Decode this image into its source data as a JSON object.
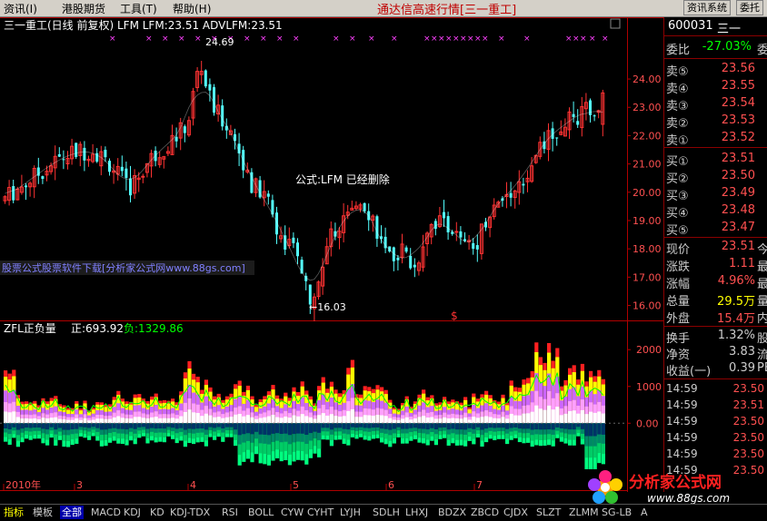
{
  "menu": {
    "items": [
      "资讯(I)",
      "港股期货",
      "工具(T)",
      "帮助(H)"
    ],
    "title": "通达信高速行情[三一重工]",
    "buttons": [
      "资讯系统",
      "委托"
    ]
  },
  "main_chart": {
    "header": "三一重工(日线 前复权) LFM LFM:23.51 ADVLFM:23.51",
    "annotations": {
      "high": "24.69",
      "low": "←16.03",
      "formula_note": "公式:LFM 已经删除",
      "watermark_text": "股票公式股票软件下载[分析家公式网www.88gs.com]",
      "dollar_mark": "$"
    },
    "y_axis_labels": [
      "24.00",
      "23.00",
      "22.00",
      "21.00",
      "20.00",
      "19.00",
      "18.00",
      "17.00",
      "16.00"
    ]
  },
  "sub_chart": {
    "header_name": "ZFL正负量",
    "pos_label": "正:693.92",
    "neg_label": "负:1329.86",
    "y_axis_labels": [
      "2000",
      "1000",
      "0.00"
    ]
  },
  "date_axis": [
    "2010年",
    "3",
    "4",
    "5",
    "6",
    "7"
  ],
  "chart_data": {
    "type": "candlestick",
    "title": "三一重工(日线 前复权)",
    "ylim": [
      15.6,
      24.9
    ],
    "high": 24.69,
    "low": 16.03,
    "last": 23.51,
    "sub_ylim": [
      -1300,
      2400
    ],
    "pos_last": 693.92,
    "neg_last": 1329.86
  },
  "quote": {
    "code": "600031",
    "name": "三一",
    "weibi_label": "委比",
    "weibi_value": "-27.03%",
    "weibi_extra": "委",
    "asks": [
      {
        "label": "卖⑤",
        "price": "23.56"
      },
      {
        "label": "卖④",
        "price": "23.55"
      },
      {
        "label": "卖③",
        "price": "23.54"
      },
      {
        "label": "卖②",
        "price": "23.53"
      },
      {
        "label": "卖①",
        "price": "23.52"
      }
    ],
    "bids": [
      {
        "label": "买①",
        "price": "23.51"
      },
      {
        "label": "买②",
        "price": "23.50"
      },
      {
        "label": "买③",
        "price": "23.49"
      },
      {
        "label": "买④",
        "price": "23.48"
      },
      {
        "label": "买⑤",
        "price": "23.47"
      }
    ],
    "stats": [
      {
        "label": "现价",
        "value": "23.51",
        "extra": "今",
        "color": "#ff5050"
      },
      {
        "label": "涨跌",
        "value": "1.11",
        "extra": "最",
        "color": "#ff5050"
      },
      {
        "label": "涨幅",
        "value": "4.96%",
        "extra": "最",
        "color": "#ff5050"
      },
      {
        "label": "总量",
        "value": "29.5万",
        "extra": "量",
        "color": "#ffff00"
      },
      {
        "label": "外盘",
        "value": "15.4万",
        "extra": "内",
        "color": "#ff5050"
      }
    ],
    "stats2": [
      {
        "label": "换手",
        "value": "1.32%",
        "extra": "股",
        "color": "#cccccc"
      },
      {
        "label": "净资",
        "value": "3.83",
        "extra": "流",
        "color": "#cccccc"
      },
      {
        "label": "收益(一)",
        "value": "0.39",
        "extra": "PE",
        "color": "#cccccc"
      }
    ],
    "ticks": [
      {
        "time": "14:59",
        "price": "23.50"
      },
      {
        "time": "14:59",
        "price": "23.51"
      },
      {
        "time": "14:59",
        "price": "23.50"
      },
      {
        "time": "14:59",
        "price": "23.50"
      },
      {
        "time": "14:59",
        "price": "23.50"
      },
      {
        "time": "14:59",
        "price": "23.50"
      }
    ]
  },
  "bottom_tabs": [
    "指标",
    "模板",
    "全部",
    "MACD",
    "KDJ",
    "KD",
    "KDJ-TDX",
    "RSI",
    "BOLL",
    "CYW",
    "CYHT",
    "LYJH",
    "SDLH",
    "LHXJ",
    "BDZX",
    "ZBCD",
    "CJDX",
    "SLZT",
    "ZLMM",
    "SG-LB",
    "A"
  ],
  "watermark": {
    "brand": "分析家公式网",
    "url": "www.88gs.com"
  },
  "colors": {
    "up": "#ff3232",
    "down": "#54ffff",
    "ma": "#ffffff",
    "axis": "#b00000"
  }
}
